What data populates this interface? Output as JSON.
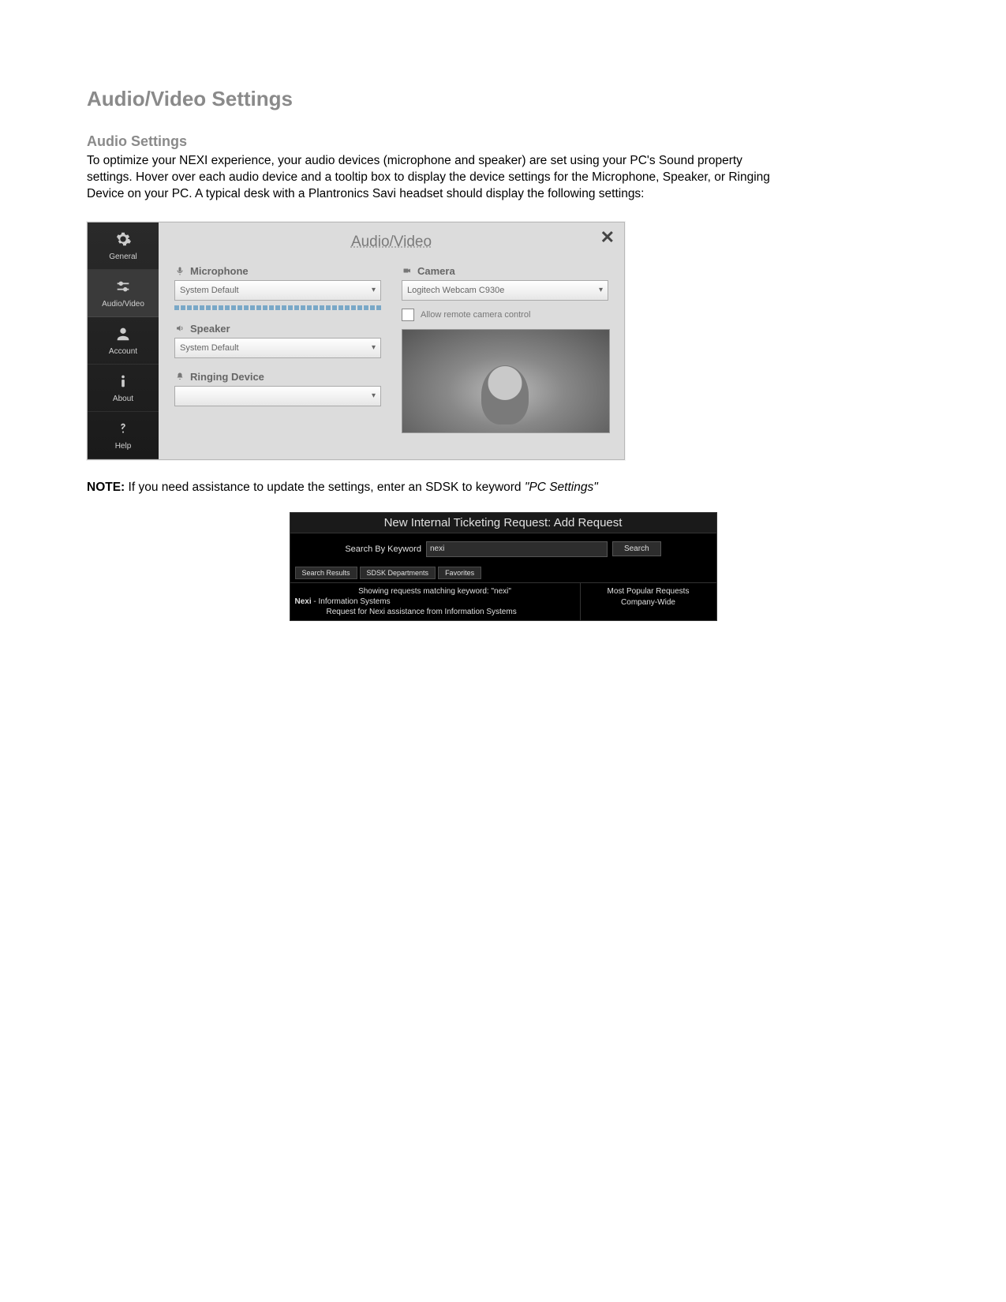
{
  "headings": {
    "main": "Audio/Video Settings",
    "audio": "Audio Settings"
  },
  "paragraphs": {
    "intro": "To optimize your NEXI experience, your audio devices (microphone and speaker) are set using your PC's Sound property settings. Hover over each audio device and a tooltip box to display the device settings for the Microphone, Speaker, or Ringing Device on your PC. A typical desk with a Plantronics Savi headset should display the following settings:"
  },
  "dialog": {
    "title": "Audio/Video",
    "nav": [
      "General",
      "Audio/Video",
      "Account",
      "About",
      "Help"
    ],
    "microphone": {
      "label": "Microphone",
      "value": "System Default"
    },
    "speaker": {
      "label": "Speaker",
      "value": "System Default"
    },
    "ringing": {
      "label": "Ringing Device",
      "value": ""
    },
    "camera": {
      "label": "Camera",
      "value": "Logitech Webcam C930e"
    },
    "remote_cb": "Allow remote camera control"
  },
  "note": {
    "prefix": "NOTE:",
    "body": " If you need assistance to update the settings, enter an SDSK to keyword ",
    "keyword": "\"PC Settings\""
  },
  "ticket": {
    "title": "New Internal Ticketing Request: Add Request",
    "search_label": "Search By Keyword",
    "search_value": "nexi",
    "search_btn": "Search",
    "tabs": [
      "Search Results",
      "SDSK Departments",
      "Favorites"
    ],
    "matching": "Showing requests matching keyword: \"nexi\"",
    "line1_a": "Nexi",
    "line1_b": " - Information Systems",
    "line2": "Request for Nexi assistance from Information Systems",
    "popular1": "Most Popular Requests",
    "popular2": "Company-Wide"
  }
}
